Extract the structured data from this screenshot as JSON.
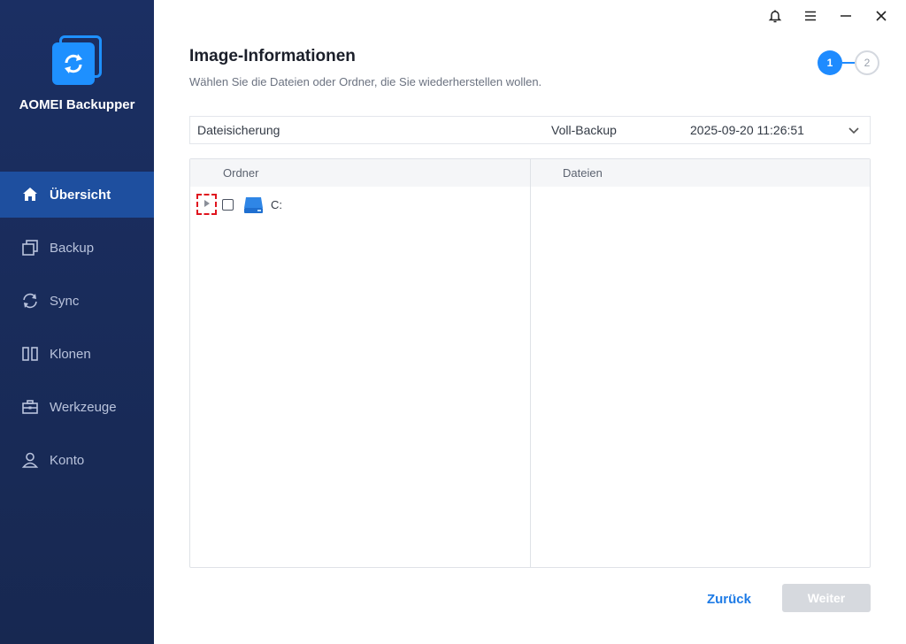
{
  "app": {
    "name": "AOMEI Backupper"
  },
  "sidebar": {
    "items": [
      {
        "label": "Übersicht",
        "icon": "home-icon",
        "active": true
      },
      {
        "label": "Backup",
        "icon": "backup-icon"
      },
      {
        "label": "Sync",
        "icon": "sync-icon"
      },
      {
        "label": "Klonen",
        "icon": "clone-icon"
      },
      {
        "label": "Werkzeuge",
        "icon": "toolbox-icon"
      },
      {
        "label": "Konto",
        "icon": "user-icon"
      }
    ]
  },
  "window_controls": [
    "bell-icon",
    "menu-icon",
    "minimize-icon",
    "close-icon"
  ],
  "header": {
    "title": "Image-Informationen",
    "subtitle": "Wählen Sie die Dateien oder Ordner, die Sie wiederherstellen wollen."
  },
  "steps": {
    "current": "1",
    "next": "2"
  },
  "backup_select": {
    "name": "Dateisicherung",
    "type": "Voll-Backup",
    "time": "2025-09-20 11:26:51"
  },
  "panels": {
    "folders_header": "Ordner",
    "files_header": "Dateien",
    "tree": [
      {
        "label": "C:"
      }
    ]
  },
  "footer": {
    "back_label": "Zurück",
    "next_label": "Weiter"
  },
  "colors": {
    "sidebar_bg": "#1b2f63",
    "accent": "#1e8bff",
    "active_nav": "#1e4f9f"
  }
}
